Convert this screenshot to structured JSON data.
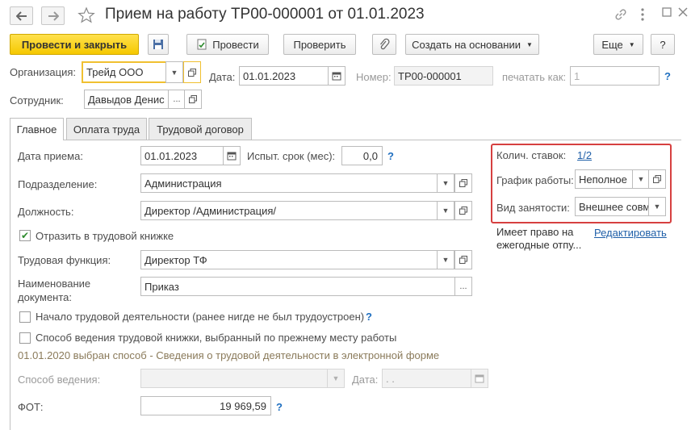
{
  "window": {
    "title": "Прием на работу ТР00-000001 от 01.01.2023"
  },
  "toolbar": {
    "post_close": "Провести и закрыть",
    "post": "Провести",
    "check": "Проверить",
    "create_based": "Создать на основании",
    "more": "Еще",
    "help": "?"
  },
  "header": {
    "org_label": "Организация:",
    "org_value": "Трейд ООО",
    "date_label": "Дата:",
    "date_value": "01.01.2023",
    "number_label": "Номер:",
    "number_value": "ТР00-000001",
    "print_as_label": "печатать как:",
    "print_as_value": "1",
    "help": "?",
    "employee_label": "Сотрудник:",
    "employee_value": "Давыдов Денис",
    "employee_btn": "..."
  },
  "tabs": [
    {
      "label": "Главное",
      "active": true
    },
    {
      "label": "Оплата труда",
      "active": false
    },
    {
      "label": "Трудовой договор",
      "active": false
    }
  ],
  "main": {
    "hire_date_label": "Дата приема:",
    "hire_date_value": "01.01.2023",
    "trial_label": "Испыт. срок (мес):",
    "trial_value": "0,0",
    "trial_help": "?",
    "dept_label": "Подразделение:",
    "dept_value": "Администрация",
    "position_label": "Должность:",
    "position_value": "Директор /Администрация/",
    "workbook_checkbox_label": "Отразить в трудовой книжке",
    "workbook_checked": true,
    "function_label": "Трудовая функция:",
    "function_value": "Директор ТФ",
    "doc_name_label_1": "Наименование",
    "doc_name_label_2": "документа:",
    "doc_name_value": "Приказ",
    "doc_name_btn": "...",
    "start_checkbox_label": "Начало трудовой деятельности (ранее нигде не был трудоустроен)",
    "start_help": "?",
    "method_checkbox_label": "Способ ведения трудовой книжки, выбранный по прежнему месту работы",
    "method_note": "01.01.2020 выбран способ - Сведения о трудовой деятельности в электронной форме",
    "method_label": "Способ ведения:",
    "method_value": "",
    "method_date_label": "Дата:",
    "method_date_value": " .  .",
    "fot_label": "ФОТ:",
    "fot_value": "19 969,59",
    "fot_help": "?"
  },
  "right_panel": {
    "rates_label": "Колич. ставок:",
    "rates_value": "1/2",
    "schedule_label": "График работы:",
    "schedule_value": "Неполное",
    "employment_label": "Вид занятости:",
    "employment_value": "Внешнее совм",
    "vacation_text_1": "Имеет право на",
    "vacation_text_2": "ежегодные отпу...",
    "edit_link": "Редактировать"
  },
  "colors": {
    "primary_button": "#f5c800",
    "link": "#1f5fa8",
    "highlight_border": "#d64040",
    "focus_border": "#f0c030"
  },
  "icons": {
    "back": "arrow-left-icon",
    "forward": "arrow-right-icon",
    "favorite": "star-icon",
    "link": "link-icon",
    "menu": "more-vertical-icon",
    "maximize": "maximize-icon",
    "close": "close-icon",
    "save": "floppy-disk-icon",
    "post": "document-post-icon",
    "attach": "paperclip-icon",
    "calendar": "calendar-icon",
    "open": "open-form-icon"
  }
}
